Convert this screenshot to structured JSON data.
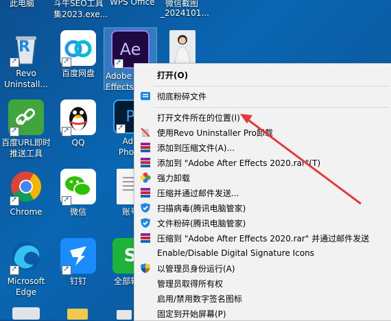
{
  "top_labels": [
    "此电脑",
    "斗牛SEO工具",
    "集2023.exe...",
    "WPS Office",
    "微信截图",
    "_2024101..."
  ],
  "desktop_icons": [
    {
      "id": "revo",
      "label": "Revo\nUninstall..."
    },
    {
      "id": "baidu-pan",
      "label": "百度网盘"
    },
    {
      "id": "adobe-ae",
      "label": "Adobe\nEffects"
    },
    {
      "id": "photo",
      "label": ""
    },
    {
      "id": "baidu-url",
      "label": "百度URL即时\n推送工具"
    },
    {
      "id": "qq",
      "label": "QQ"
    },
    {
      "id": "photoshop",
      "label": "Ado\nPhoto"
    },
    {
      "id": "chrome",
      "label": "Chrome"
    },
    {
      "id": "wechat",
      "label": "微信"
    },
    {
      "id": "account",
      "label": "账号"
    },
    {
      "id": "edge",
      "label": "Microsoft\nEdge"
    },
    {
      "id": "dingding",
      "label": "钉钉"
    },
    {
      "id": "all-software",
      "label": "全部软件"
    }
  ],
  "context_menu": {
    "items": [
      {
        "label": "打开(O)",
        "bold": true
      },
      {
        "label": "彻底粉碎文件"
      },
      {
        "label": "打开文件所在的位置(I)"
      },
      {
        "label": "使用Revo Uninstaller Pro卸载"
      },
      {
        "label": "添加到压缩文件(A)..."
      },
      {
        "label": "添加到 \"Adobe After Effects 2020.rar\"(T)"
      },
      {
        "label": "强力卸载"
      },
      {
        "label": "压缩并通过邮件发送..."
      },
      {
        "label": "扫描病毒(腾讯电脑管家)"
      },
      {
        "label": "文件粉碎(腾讯电脑管家)"
      },
      {
        "label": "压缩到 \"Adobe After Effects 2020.rar\" 并通过邮件发送"
      },
      {
        "label": "Enable/Disable Digital Signature Icons"
      },
      {
        "label": "以管理员身份运行(A)"
      },
      {
        "label": "管理员取得所有权"
      },
      {
        "label": "启用/禁用数字签名图标"
      },
      {
        "label": "固定到开始屏幕(P)"
      }
    ]
  },
  "colors": {
    "annotation_arrow": "#e53935",
    "desktop_bg": "#0a66b2"
  }
}
